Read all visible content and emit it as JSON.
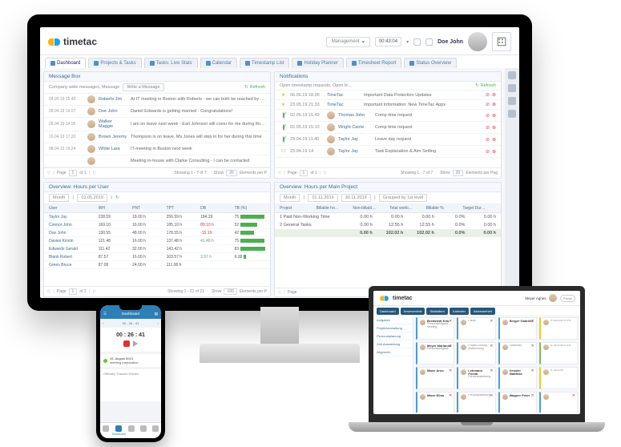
{
  "brand": "timetac",
  "header": {
    "username": "Doe John",
    "management": "Management",
    "timer": "00:43:04"
  },
  "tabs": [
    "Dashboard",
    "Projects & Tasks",
    "Tasks: Live Stats",
    "Calendar",
    "Timestamp List",
    "Holiday Planner",
    "Timesheet Report",
    "Status Overview"
  ],
  "message_box": {
    "title": "Message Box",
    "subtitle": "Company wide messages, Message",
    "write": "Write a Message",
    "refresh": "Refresh",
    "rows": [
      {
        "ts": "04.05.19 15.40",
        "nm": "Roberts Jim",
        "tx": "At IT meeting in Boston with Roberts - we can both be reached by mobile"
      },
      {
        "ts": "28.04.19 14.07",
        "nm": "Doe John",
        "tx": "Daniel Edwards is getting married - Congratulations!"
      },
      {
        "ts": "28.04.19 14.06",
        "nm": "Walker Maggie",
        "tx": "I am on leave next week - Earl Johnson will cover for me during this time"
      },
      {
        "ts": "16.04.19 17.20",
        "nm": "Brown Jeremy",
        "tx": "Thompson is on leave, Ms Jones will step in for her during this time"
      },
      {
        "ts": "08.04.19 19.24",
        "nm": "White Lara",
        "tx": "IT-meeting in Boston next week"
      },
      {
        "ts": "",
        "nm": "",
        "tx": "Meeting in-house with Clarke Consulting - I can be contacted"
      }
    ],
    "pager": {
      "page": "1",
      "of": "of 1",
      "mid": "Showing 1 - 7 of 7",
      "show": "20",
      "ep": "Elements per P"
    }
  },
  "notifications": {
    "title": "Notifications",
    "subtitle": "Open timestamp requests, Open le…",
    "refresh": "Refresh",
    "rows": [
      {
        "sig": "star",
        "dt": "06.06.19 18.09",
        "nm": "TimeTac",
        "sub": "Important Data Protection Updates"
      },
      {
        "sig": "star",
        "dt": "23.05.19 21.33",
        "nm": "TimeTac",
        "sub": "Important Information: New TimeTac Apps"
      },
      {
        "sig": "ok",
        "dt": "02.05.19 15.49",
        "av": true,
        "nm": "Thomas John",
        "sub": "Comp time request"
      },
      {
        "sig": "ok",
        "dt": "02.05.19 15.10",
        "av": true,
        "nm": "Wright Carrie",
        "sub": "Comp time request"
      },
      {
        "sig": "ok",
        "dt": "29.04.19 11.40",
        "av": true,
        "nm": "Taylor Jay",
        "sub": "Leave day request"
      },
      {
        "sig": "cal",
        "dt": "23.04.19 14",
        "av": true,
        "nm": "Taylor Jay",
        "sub": "Task Explanation & Aim Setting"
      }
    ],
    "pager": {
      "page": "1",
      "of": "of 1",
      "mid": "Showing 1 - 7 of 7",
      "show": "20",
      "ep": "Elements per Pag"
    }
  },
  "overview_user": {
    "title": "Overview: Hours per User",
    "month": "Month",
    "from": "01.05.2019",
    "cols": [
      "User",
      "WH",
      "PNT",
      "TPT",
      "DB",
      "TB (%)"
    ],
    "rows": [
      {
        "u": "Taylor Jay",
        "wh": "238.59",
        "pnt": "18.00 h",
        "tpt": "256.59 h",
        "db": "184.29",
        "tb": 75,
        "bar": 75
      },
      {
        "u": "Connor John",
        "wh": "169.10",
        "pnt": "16.00 h",
        "tpt": "185.10 h",
        "db": "89.10 h",
        "tb": 52,
        "bar": 52,
        "pos": true,
        "neg": true
      },
      {
        "u": "Doe John",
        "wh": "130.55",
        "pnt": "48.00 h",
        "tpt": "178.55 h",
        "db": "-15.19",
        "tb": 42,
        "bar": 42,
        "neg": true
      },
      {
        "u": "Davies Kirstin",
        "wh": "121.48",
        "pnt": "16.00 h",
        "tpt": "137.48 h",
        "db": "41.48 h",
        "tb": 75,
        "bar": 75,
        "pos": true
      },
      {
        "u": "Edwards Gerald",
        "wh": "111.42",
        "pnt": "32.00 h",
        "tpt": "143.42 h",
        "db": "",
        "tb": 83,
        "bar": 83
      },
      {
        "u": "Blank Robert",
        "wh": "87.57",
        "pnt": "16.00 h",
        "tpt": "103.57 h",
        "db": "3.57 h",
        "tb": 6.38,
        "bar": 6,
        "pos": true
      },
      {
        "u": "Green Bruce",
        "wh": "87.08",
        "pnt": "24.00 h",
        "tpt": "111.08 h",
        "db": "",
        "tb": "",
        "bar": 0
      }
    ],
    "pager": {
      "page": "1",
      "of": "of 2",
      "mid": "Showing 1 - 21 of 21",
      "show": "100",
      "ep": "Elements per P"
    }
  },
  "overview_proj": {
    "title": "Overview: Hours per Main Project",
    "month": "Month",
    "from": "01.11.2019",
    "to": "30.11.2019",
    "group": "Grouped by 1st level",
    "cols": [
      "Project",
      "Billable ho…",
      "Non-billabl…",
      "Total worki…",
      "Billable %",
      "Target Dur…"
    ],
    "rows": [
      {
        "p": "1 Paid Non-Working Time",
        "b": "0.00 h",
        "nb": "0.00 h",
        "t": "0.00 h",
        "pc": "0.0%",
        "td": "0.00 h"
      },
      {
        "p": "2 General Tasks",
        "b": "0.00 h",
        "nb": "12.55 h",
        "t": "12.55 h",
        "pc": "0.0%",
        "td": "0.00 h"
      }
    ],
    "sum": {
      "p": "",
      "b": "0.00 h",
      "nb": "102.02 h",
      "t": "102.02 h",
      "pc": "0.0%",
      "td": "0.00 h"
    },
    "pager": {
      "page": "Page"
    }
  },
  "phone": {
    "title": "Dashboard",
    "date": "00 - 26 - 41",
    "timer": "00 : 26 : 41",
    "task": "15. August 0013",
    "subtask": "meeting preparation",
    "nav": [
      "",
      "Dashboard",
      "",
      "",
      ""
    ]
  },
  "laptop": {
    "user": "Meyer Agnes",
    "tabs": [
      "Dashboard",
      "Anwesenheit",
      "Statistiken",
      "Kalender",
      "Abwesenheit"
    ],
    "side": [
      "Aufgaben",
      "Projektverwaltung",
      "Personalplanung",
      "Zeit-Auswertung",
      "Allgemein"
    ],
    "cards": [
      {
        "c": "b",
        "n": "Breitstedt Kim",
        "s": "Personalaufgabe Meeting",
        "x": true
      },
      {
        "c": "b",
        "n": "",
        "s": "Pause",
        "x": true
      },
      {
        "c": "b",
        "n": "Berger Gabriele",
        "s": "",
        "x": true
      },
      {
        "c": "y",
        "n": "",
        "s": "h: 08.2019 0.0%",
        "x": false
      },
      {
        "c": "b",
        "n": "Meyer Marianne",
        "s": "Personalaufgabe",
        "x": true
      },
      {
        "c": "b",
        "n": "",
        "s": "Projekt-Leitung Abstimmung",
        "x": true
      },
      {
        "c": "b",
        "n": "",
        "s": "Statement",
        "x": true
      },
      {
        "c": "g",
        "n": "",
        "s": "h: 08.2019 0.0%",
        "x": false
      },
      {
        "c": "b",
        "n": "Maier Arno",
        "s": "",
        "x": true
      },
      {
        "c": "b",
        "n": "Lehmann Frieda",
        "s": "Personalabteilung",
        "x": true
      },
      {
        "c": "b",
        "n": "Kessler Matthias",
        "s": "",
        "x": true
      },
      {
        "c": "y",
        "n": "",
        "s": "h: 08.2019",
        "x": false
      },
      {
        "c": "b",
        "n": "Mann Elisa",
        "s": "",
        "x": true
      },
      {
        "c": "b",
        "n": "",
        "s": "Personalabteilung",
        "x": true
      },
      {
        "c": "b",
        "n": "Wagner Peter",
        "s": "",
        "x": true
      },
      {
        "c": "b",
        "n": "",
        "s": "",
        "x": true
      }
    ]
  }
}
